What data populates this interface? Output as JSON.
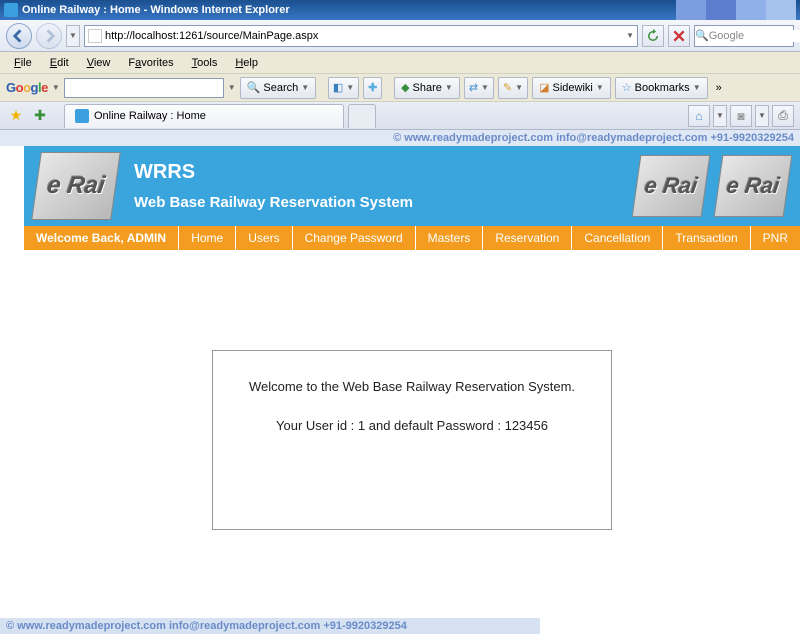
{
  "window": {
    "title": "Online Railway : Home - Windows Internet Explorer"
  },
  "address": {
    "url": "http://localhost:1261/source/MainPage.aspx"
  },
  "search": {
    "engine": "Google"
  },
  "menubar": [
    "File",
    "Edit",
    "View",
    "Favorites",
    "Tools",
    "Help"
  ],
  "googlebar": {
    "search_label": "Search",
    "share_label": "Share",
    "sidewiki_label": "Sidewiki",
    "bookmarks_label": "Bookmarks"
  },
  "tab": {
    "title": "Online Railway : Home"
  },
  "watermark": "©  www.readymadeproject.com  info@readymadeproject.com  +91-9920329254",
  "banner": {
    "logo_text": "e Rai",
    "acronym": "WRRS",
    "subtitle": "Web Base Railway Reservation System"
  },
  "nav": {
    "welcome": "Welcome Back, ADMIN",
    "items": [
      "Home",
      "Users",
      "Change Password",
      "Masters",
      "Reservation",
      "Cancellation",
      "Transaction",
      "PNR"
    ]
  },
  "welcomebox": {
    "line1": "Welcome to the Web Base Railway Reservation System.",
    "line2": "Your User id : 1 and default Password : 123456"
  }
}
